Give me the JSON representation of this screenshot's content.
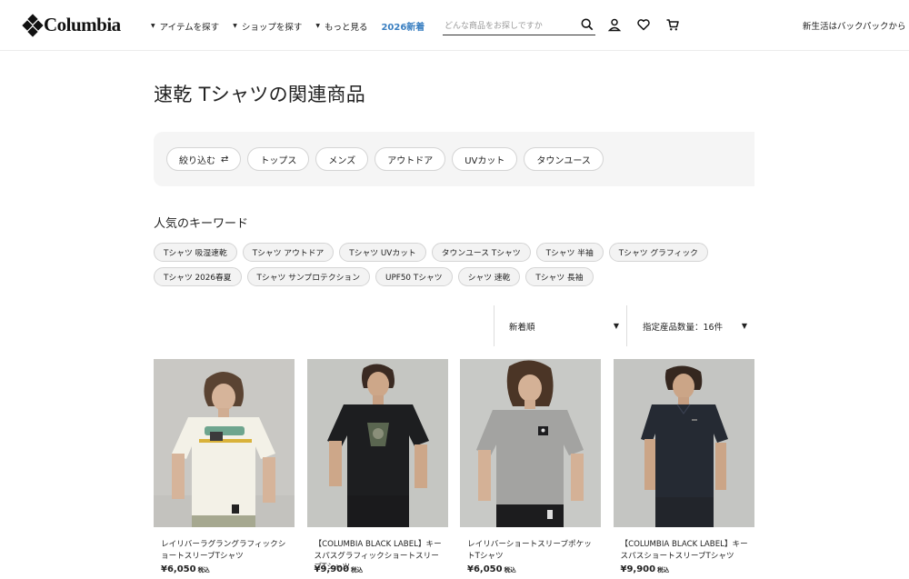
{
  "header": {
    "logo_text": "Columbia",
    "nav": [
      "アイテムを探す",
      "ショップを探す",
      "もっと見る"
    ],
    "nav_new": "2026新着",
    "search_placeholder": "どんな商品をお探しですか",
    "promo_text": "新生活はバックパックから ›"
  },
  "page_title": "速乾 Tシャツの関連商品",
  "filter_chips": [
    "絞り込む",
    "トップス",
    "メンズ",
    "アウトドア",
    "UVカット",
    "タウンユース"
  ],
  "keywords": {
    "title": "人気のキーワード",
    "items": [
      "Tシャツ 吸湿速乾",
      "Tシャツ アウトドア",
      "Tシャツ UVカット",
      "タウンユース Tシャツ",
      "Tシャツ 半袖",
      "Tシャツ グラフィック",
      "Tシャツ 2026春夏",
      "Tシャツ サンプロテクション",
      "UPF50 Tシャツ",
      "シャツ 速乾",
      "Tシャツ 長袖"
    ]
  },
  "sort": {
    "order": "新着順",
    "count": "指定産品数量：16件"
  },
  "products": [
    {
      "name": "レイリバーラグラングラフィックショートスリーブTシャツ",
      "price": "¥6,050",
      "tax": "税込"
    },
    {
      "name": "【COLUMBIA BLACK LABEL】キースパスグラフィックショートスリーブTシャツ",
      "price": "¥9,900",
      "tax": "税込"
    },
    {
      "name": "レイリバーショートスリーブポケットTシャツ",
      "price": "¥6,050",
      "tax": "税込"
    },
    {
      "name": "【COLUMBIA BLACK LABEL】キースパスショートスリーブTシャツ",
      "price": "¥9,900",
      "tax": "税込"
    }
  ],
  "colors": {
    "accent_new": "#3a7fc1",
    "filter_bar_bg": "#f5f5f5"
  }
}
